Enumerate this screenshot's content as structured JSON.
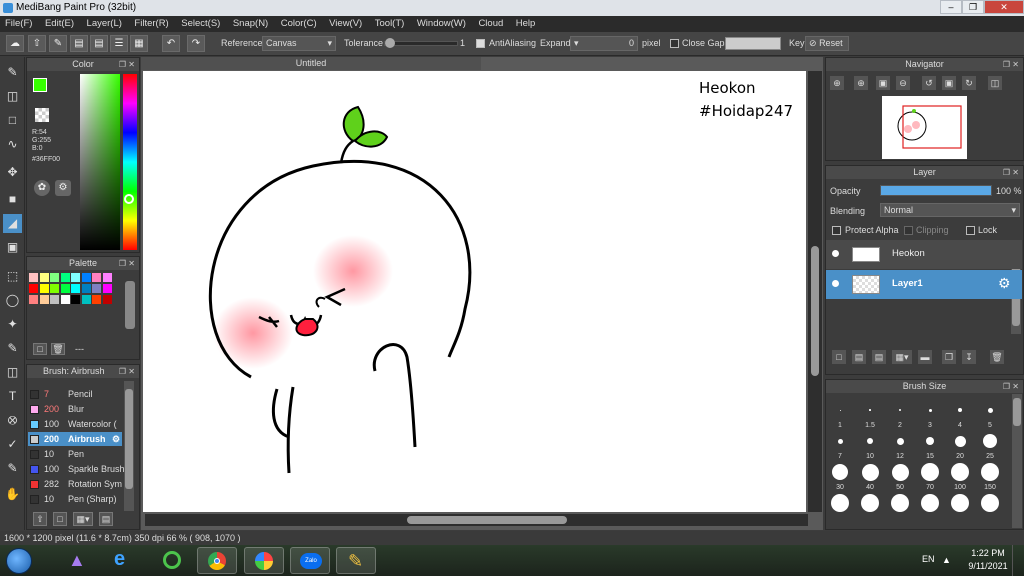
{
  "window": {
    "title": "MediBang Paint Pro (32bit)"
  },
  "menu": [
    "File(F)",
    "Edit(E)",
    "Layer(L)",
    "Filter(R)",
    "Select(S)",
    "Snap(N)",
    "Color(C)",
    "View(V)",
    "Tool(T)",
    "Window(W)",
    "Cloud",
    "Help"
  ],
  "toolbar": {
    "reference_label": "Reference",
    "reference_value": "Canvas",
    "tolerance_label": "Tolerance",
    "tolerance_value": "1",
    "tolerance_level": 0.01,
    "antialiasing_label": "AntiAliasing",
    "expand_label": "Expand",
    "expand_value": "0",
    "expand_unit": "pixel",
    "close_gaps_label": "Close Gaps",
    "key_label": "Key",
    "reset_label": "Reset"
  },
  "color_panel": {
    "title": "Color",
    "r": "R:54",
    "g": "G:255",
    "b": "B:0",
    "hex": "#36FF00",
    "current": "#36ff00"
  },
  "palette_panel": {
    "title": "Palette",
    "footer": "---",
    "swatches": [
      "#ffc0c0",
      "#ffff80",
      "#80ff80",
      "#00ff80",
      "#80ffff",
      "#0080ff",
      "#ff80c0",
      "#ff80ff",
      "#ff0000",
      "#ffff00",
      "#80ff00",
      "#00ff40",
      "#00ffff",
      "#0080c0",
      "#8080c0",
      "#ff00ff",
      "#ff8080",
      "#ffcc99",
      "#c0c0c0",
      "#ffffff",
      "#000000",
      "#00c0c0",
      "#ff4000",
      "#c00000"
    ]
  },
  "brush_panel": {
    "title": "Brush: Airbrush",
    "items": [
      {
        "size": "7",
        "name": "Pencil",
        "color": "#333333"
      },
      {
        "size": "200",
        "name": "Blur",
        "color": "#ffaaee"
      },
      {
        "size": "100",
        "name": "Watercolor (",
        "color": "#66ccff"
      },
      {
        "size": "200",
        "name": "Airbrush",
        "color": "#cccccc"
      },
      {
        "size": "10",
        "name": "Pen",
        "color": "#333333"
      },
      {
        "size": "100",
        "name": "Sparkle Brush",
        "color": "#4455ee"
      },
      {
        "size": "282",
        "name": "Rotation Sym",
        "color": "#ee3333"
      },
      {
        "size": "10",
        "name": "Pen (Sharp)",
        "color": "#333333"
      }
    ],
    "selected_index": 3
  },
  "canvas": {
    "tab_title": "Untitled",
    "text_line1": "Heokon",
    "text_line2": "#Hoidap247"
  },
  "navigator_panel": {
    "title": "Navigator"
  },
  "layer_panel": {
    "title": "Layer",
    "opacity_label": "Opacity",
    "opacity_value": "100 %",
    "opacity_level": 1,
    "blending_label": "Blending",
    "blending_value": "Normal",
    "protect_alpha_label": "Protect Alpha",
    "clipping_label": "Clipping",
    "lock_label": "Lock",
    "layers": [
      {
        "name": "Heokon",
        "selected": false
      },
      {
        "name": "Layer1",
        "selected": true
      }
    ]
  },
  "brush_size_panel": {
    "title": "Brush Size",
    "sizes": [
      "1",
      "1.5",
      "2",
      "3",
      "4",
      "5",
      "7",
      "10",
      "12",
      "15",
      "20",
      "25",
      "30",
      "40",
      "50",
      "70",
      "100",
      "150"
    ]
  },
  "statusbar": {
    "text": "1600 * 1200 pixel   (11.6 * 8.7cm)   350 dpi   66 %   ( 908, 1070 )"
  },
  "taskbar": {
    "language": "EN",
    "time": "1:22 PM",
    "date": "9/11/2021",
    "zalo_label": "Zalo"
  }
}
